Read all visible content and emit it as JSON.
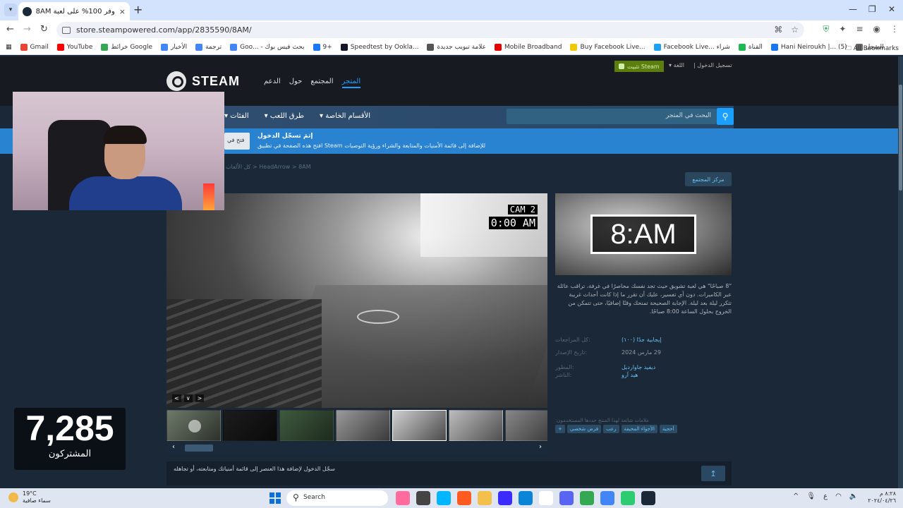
{
  "browser": {
    "tab_title": "وفر 100% على لعبة 8AM على ...",
    "tab_close": "×",
    "new_tab": "+",
    "url": "store.steampowered.com/app/2835590/8AM/",
    "bookmarks": [
      {
        "label": "Gmail",
        "color": "#ea4335"
      },
      {
        "label": "YouTube",
        "color": "#ff0000"
      },
      {
        "label": "خرائط Google",
        "color": "#34a853"
      },
      {
        "label": "الأخبار",
        "color": "#4285f4"
      },
      {
        "label": "ترجمة",
        "color": "#4285f4"
      },
      {
        "label": "Goo... - بحث فيس بوك",
        "color": "#4285f4"
      },
      {
        "label": "9+",
        "color": "#1877f2"
      },
      {
        "label": "Speedtest by Ookla...",
        "color": "#141526"
      },
      {
        "label": "علامة تبويب جديدة",
        "color": "#555555"
      },
      {
        "label": "Mobile Broadband",
        "color": "#e60000"
      },
      {
        "label": "Buy Facebook Live...",
        "color": "#f0c808"
      },
      {
        "label": "Facebook Live... شراء",
        "color": "#1da1f2"
      },
      {
        "label": "القناة",
        "color": "#1db954"
      },
      {
        "label": "Hani Neiroukh |... (5)",
        "color": "#1877f2"
      },
      {
        "label": "السجل",
        "color": "#666666"
      }
    ],
    "all_bookmarks": "All Bookmarks"
  },
  "steam": {
    "logo_text": "STEAM",
    "nav": [
      "المتجر",
      "المجتمع",
      "حول",
      "الدعم"
    ],
    "install_label": "تثبيت Steam",
    "language": "اللغة",
    "login": "تسجيل الدخول",
    "subnav": [
      "الأقسام الخاصة",
      "طرق اللعب",
      "الفئات"
    ],
    "search_placeholder": "البحث في المتجر",
    "banner_title": "إتمَ تسجّل الدخول",
    "banner_desc": "للإضافة إلى قائمة الأمنيات والمتابعة والشراء ورؤية التوصيات Steam افتح هذه الصفحة في تطبيق",
    "banner_open": "فتح في",
    "breadcrumb": "كل الألعاب > HeadArrow > 8AM",
    "hub_button": "مركز المجتمع",
    "cam_label": "CAM 2",
    "cam_time": "0:00 AM",
    "cam_controls": [
      "<",
      "∨",
      ">"
    ],
    "capsule_title": "8:AM",
    "description": "\"8 صباحًا\" هي لعبة تشويق حيث تجد نفسك محاصرًا في غرفة، تراقب عائلة عبر الكاميرات. دون أي تفسير، عليك أن تقرر ما إذا كانت أحداث غريبة تتكرر ليلة بعد ليلة. الإجابة الصحيحة تمنحك وقتًا إضافيًا، حتى تتمكن من الخروج بحلول الساعة 8:00 صباحًا.",
    "reviews_label": "كل المراجعات:",
    "reviews_value": "إيجابية جدًا (١٠٠)",
    "release_label": "تاريخ الإصدار:",
    "release_value": "29 مارس 2024",
    "developer_label": "المطور:",
    "developer_value": "ديفيد جاوارديل",
    "publisher_label": "الناشر:",
    "publisher_value": "هيد آرو",
    "tags_label": "علامات شائعة لهذا المنتج حددها المستخدمون:",
    "tags": [
      "أحجية",
      "الأجواء المخيفة",
      "رعب",
      "فرض شخصي",
      "+"
    ],
    "signin_note": "سجّل الدخول لإضافة هذا العنصر إلى قائمة أمنياتك ومتابعته، أو تجاهله",
    "share_icon": "↥"
  },
  "overlay": {
    "subscriber_count": "7,285",
    "subscriber_label": "المشتركون"
  },
  "taskbar": {
    "temperature": "19°C",
    "weather": "سماء صافية",
    "search": "Search",
    "app_colors": [
      "#ff6b9c",
      "#444444",
      "#00b7ff",
      "#ff5a1f",
      "#f2c04b",
      "#3b2bff",
      "#0a84d6",
      "#ffffff",
      "#5865f2",
      "#34a853",
      "#4285f4",
      "#2ecc71",
      "#1b2838"
    ],
    "clock_time": "٨:٢٨ م",
    "clock_date": "٢٠٢٤/٠٤/٢٦",
    "input_lang": "ع"
  }
}
